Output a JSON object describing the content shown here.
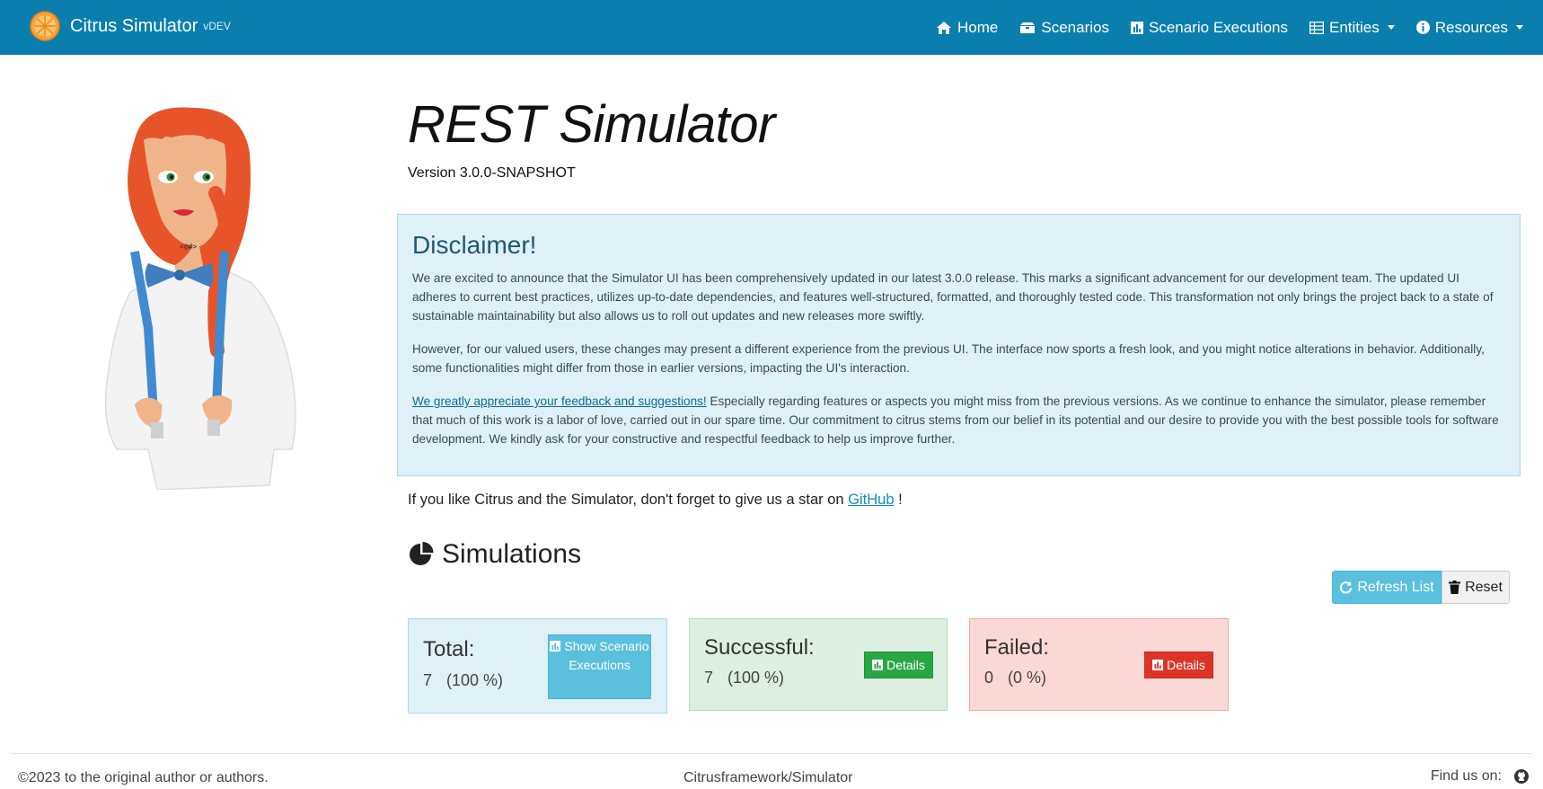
{
  "navbar": {
    "brand_name": "Citrus Simulator",
    "brand_version": "vDEV",
    "items": [
      {
        "label": "Home",
        "icon": "home-icon"
      },
      {
        "label": "Scenarios",
        "icon": "boxes-icon"
      },
      {
        "label": "Scenario Executions",
        "icon": "chart-icon"
      },
      {
        "label": "Entities",
        "icon": "table-icon",
        "dropdown": true
      },
      {
        "label": "Resources",
        "icon": "info-icon",
        "dropdown": true
      }
    ]
  },
  "main": {
    "title": "REST Simulator",
    "version": "Version 3.0.0-SNAPSHOT",
    "disclaimer": {
      "title": "Disclaimer!",
      "p1": "We are excited to announce that the Simulator UI has been comprehensively updated in our latest 3.0.0 release. This marks a significant advancement for our development team. The updated UI adheres to current best practices, utilizes up-to-date dependencies, and features well-structured, formatted, and thoroughly tested code. This transformation not only brings the project back to a state of sustainable maintainability but also allows us to roll out updates and new releases more swiftly.",
      "p2": "However, for our valued users, these changes may present a different experience from the previous UI. The interface now sports a fresh look, and you might notice alterations in behavior. Additionally, some functionalities might differ from those in earlier versions, impacting the UI's interaction.",
      "p3_link": "We greatly appreciate your feedback and suggestions!",
      "p3_rest": " Especially regarding features or aspects you might miss from the previous versions. As we continue to enhance the simulator, please remember that much of this work is a labor of love, carried out in our spare time. Our commitment to citrus stems from our belief in its potential and our desire to provide you with the best possible tools for software development. We kindly ask for your constructive and respectful feedback to help us improve further."
    },
    "star_prefix": "If you like Citrus and the Simulator, don't forget to give us a star on ",
    "star_link": "GitHub",
    "star_suffix": " !"
  },
  "simulations": {
    "heading": "Simulations",
    "refresh_label": "Refresh List",
    "reset_label": "Reset",
    "total": {
      "label": "Total:",
      "count": "7",
      "percent": "(100 %)",
      "button": "Show Scenario Executions"
    },
    "successful": {
      "label": "Successful:",
      "count": "7",
      "percent": "(100 %)",
      "button": "Details"
    },
    "failed": {
      "label": "Failed:",
      "count": "0",
      "percent": "(0 %)",
      "button": "Details"
    }
  },
  "footer": {
    "copyright": "©2023 to the original author or authors.",
    "center": "Citrusframework/Simulator",
    "find_us": "Find us on:"
  },
  "colors": {
    "navbar": "#0a7fae",
    "info": "#5bc0de",
    "success": "#28a745",
    "danger": "#dc3528"
  }
}
